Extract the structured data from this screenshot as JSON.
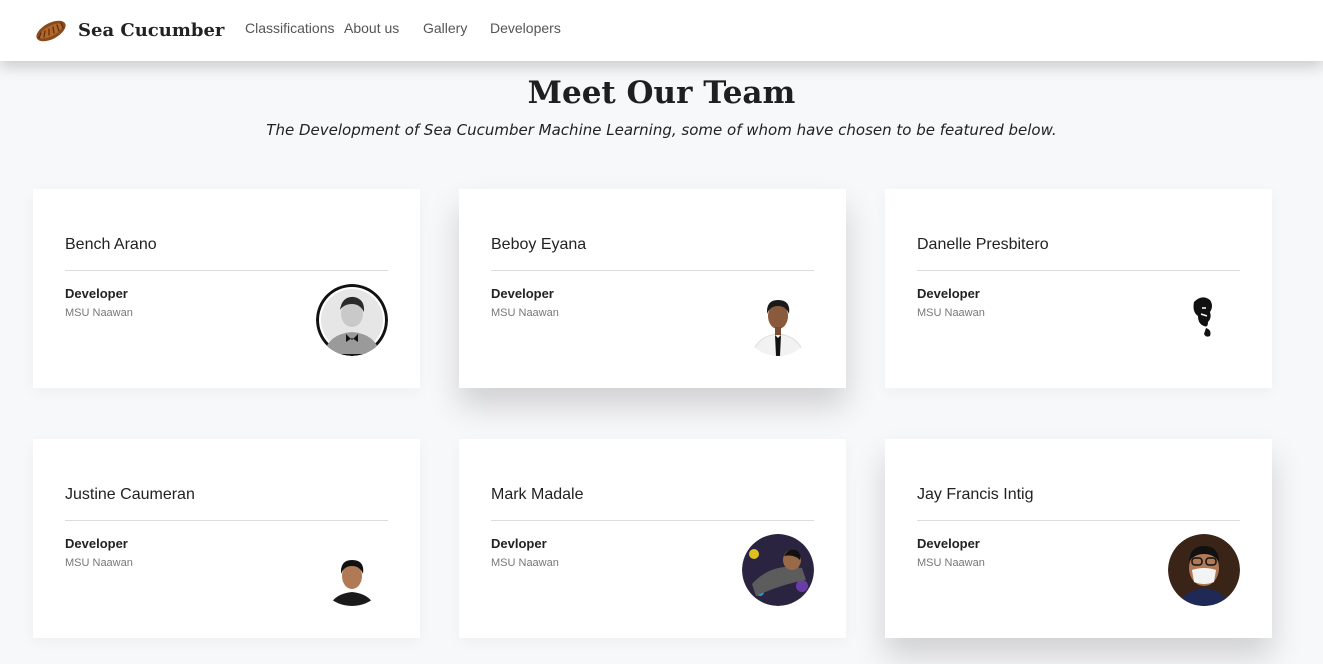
{
  "nav": {
    "brand": "Sea Cucumber",
    "links": [
      "Classifications",
      "About us",
      "Gallery",
      "Developers"
    ]
  },
  "hero": {
    "title": "Meet Our Team",
    "subtitle": "The Development of Sea Cucumber Machine Learning, some of whom have chosen to be featured below."
  },
  "team": [
    {
      "name": "Bench Arano",
      "role": "Developer",
      "org": "MSU Naawan"
    },
    {
      "name": "Beboy Eyana",
      "role": "Developer",
      "org": "MSU Naawan"
    },
    {
      "name": "Danelle Presbitero",
      "role": "Developer",
      "org": "MSU Naawan"
    },
    {
      "name": "Justine Caumeran",
      "role": "Developer",
      "org": "MSU Naawan"
    },
    {
      "name": "Mark Madale",
      "role": "Devloper",
      "org": "MSU Naawan"
    },
    {
      "name": "Jay Francis Intig",
      "role": "Developer",
      "org": "MSU Naawan"
    }
  ],
  "colors": {
    "background": "#f7f8fa",
    "card": "#ffffff",
    "text": "#222222",
    "muted": "#777777"
  }
}
